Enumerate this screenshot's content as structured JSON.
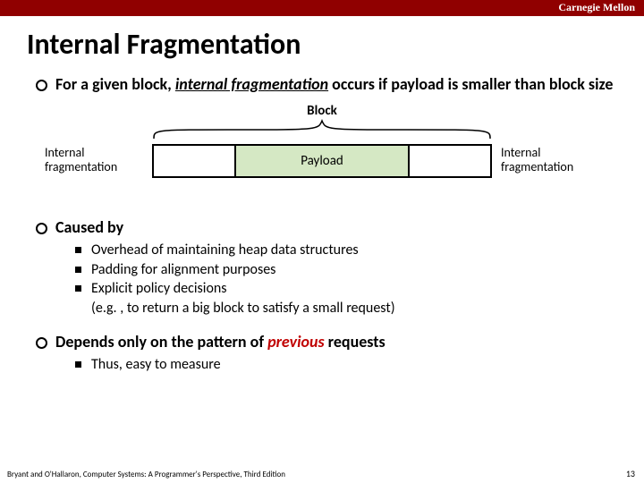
{
  "brand": "Carnegie Mellon",
  "title": "Internal Fragmentation",
  "bullets": {
    "b1_pre": "For a given block, ",
    "b1_em": "internal fragmentation",
    "b1_post": " occurs if payload is smaller than block size",
    "b2": "Caused by",
    "b2_subs": {
      "s1": "Overhead of maintaining heap data structures",
      "s2": "Padding for alignment purposes",
      "s3_a": "Explicit policy decisions",
      "s3_b": "(e.g. , to return a big block to satisfy a small request)"
    },
    "b3_pre": "Depends only on the pattern of ",
    "b3_em": "previous",
    "b3_post": " requests",
    "b3_sub": "Thus, easy to measure"
  },
  "diagram": {
    "block_label": "Block",
    "payload_label": "Payload",
    "left_label": "Internal fragmentation",
    "right_label": "Internal fragmentation"
  },
  "footer": "Bryant and O'Hallaron, Computer Systems: A Programmer's Perspective, Third Edition",
  "page": "13"
}
